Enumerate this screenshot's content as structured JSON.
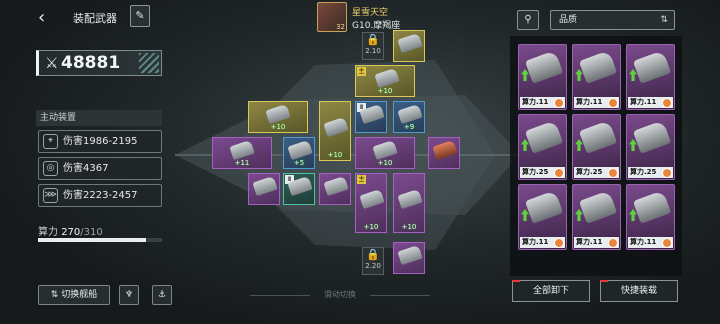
{
  "header": {
    "back_icon": "back-arrow-icon",
    "title": "装配武器",
    "edit_icon": "pen-icon"
  },
  "combat_power": {
    "value": "48881"
  },
  "main_section": {
    "title": "主动装置"
  },
  "damage_stats": [
    {
      "label": "伤害1986-2195",
      "icon": "missile-icon"
    },
    {
      "label": "伤害4367",
      "icon": "cannon-icon"
    },
    {
      "label": "伤害2223-2457",
      "icon": "multi-missile-icon"
    }
  ],
  "capacity": {
    "label": "算力",
    "used": "270",
    "total": "/310",
    "fraction": 0.871
  },
  "bottom": {
    "switch_ship": "切换舰船",
    "swipe_hint": "滑动切换"
  },
  "captain": {
    "name": "星雪天空",
    "code": "G10.摩羯座",
    "level": "32"
  },
  "slots": {
    "lock_top": "2.10",
    "lock_bottom": "2.20",
    "primary_tag": "主",
    "bonuses": [
      "+10",
      "+10",
      "+10",
      "+10",
      "+10",
      "+9",
      "+11",
      "+5",
      "+10",
      "+10",
      "+10",
      "+10"
    ]
  },
  "filter": {
    "icon": "filter-icon",
    "dropdown_value": "品质",
    "sort_icon": "sort-icon"
  },
  "inventory": [
    {
      "label": "算力.11"
    },
    {
      "label": "算力.11"
    },
    {
      "label": "算力.11"
    },
    {
      "label": "算力.25"
    },
    {
      "label": "算力.25"
    },
    {
      "label": "算力.25"
    },
    {
      "label": "算力.11"
    },
    {
      "label": "算力.11"
    },
    {
      "label": "算力.11"
    }
  ],
  "actions": {
    "unequip_all": "全部卸下",
    "quick_equip": "快捷装载"
  },
  "colors": {
    "purple": "#7c4a8f",
    "gold": "#8e8744",
    "blue": "#3b5e86",
    "teal": "#2f5d55",
    "accent_red": "#e53b3b",
    "power_border": "#68a3a3"
  }
}
